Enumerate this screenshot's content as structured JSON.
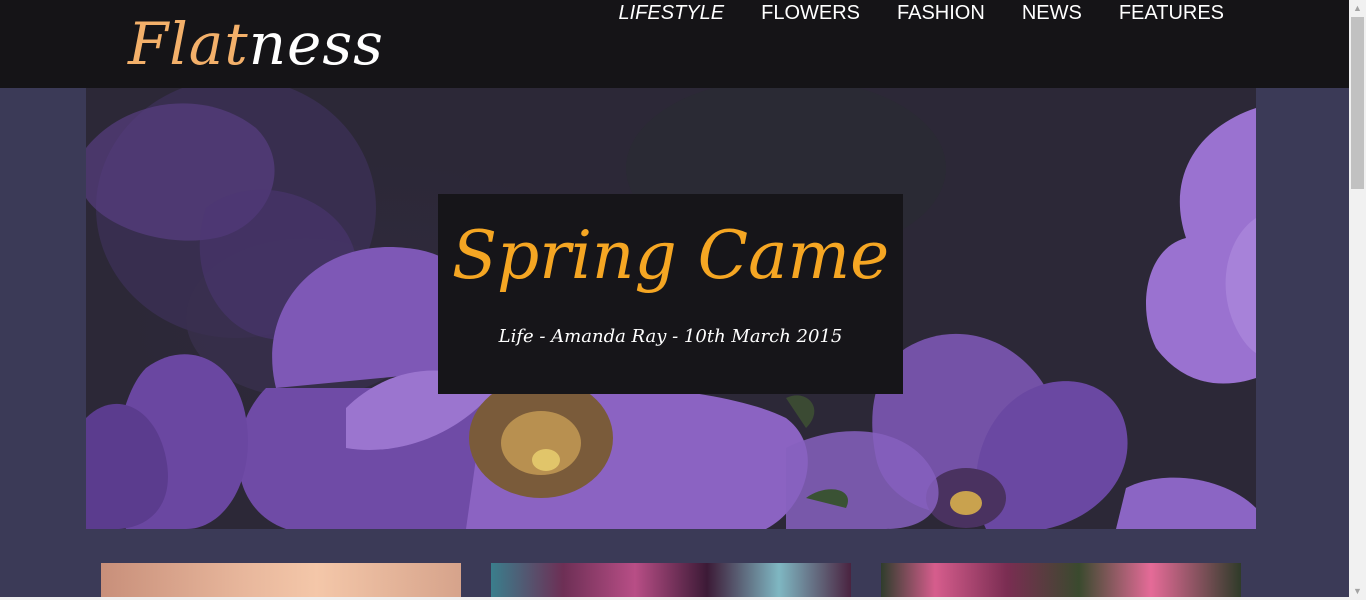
{
  "brand": {
    "part1": "Flat",
    "part2": "ness"
  },
  "nav": [
    {
      "label": "LIFESTYLE"
    },
    {
      "label": "FLOWERS"
    },
    {
      "label": "FASHION"
    },
    {
      "label": "NEWS"
    },
    {
      "label": "FEATURES"
    }
  ],
  "hero": {
    "title": "Spring Came",
    "meta": "Life - Amanda Ray - 10th March 2015"
  },
  "colors": {
    "header_bg": "#151417",
    "page_bg": "#3b3a57",
    "accent": "#f5a623",
    "logo_accent": "#f3b06a"
  },
  "icons": {
    "scroll_up": "triangle-up",
    "scroll_down": "triangle-down"
  }
}
